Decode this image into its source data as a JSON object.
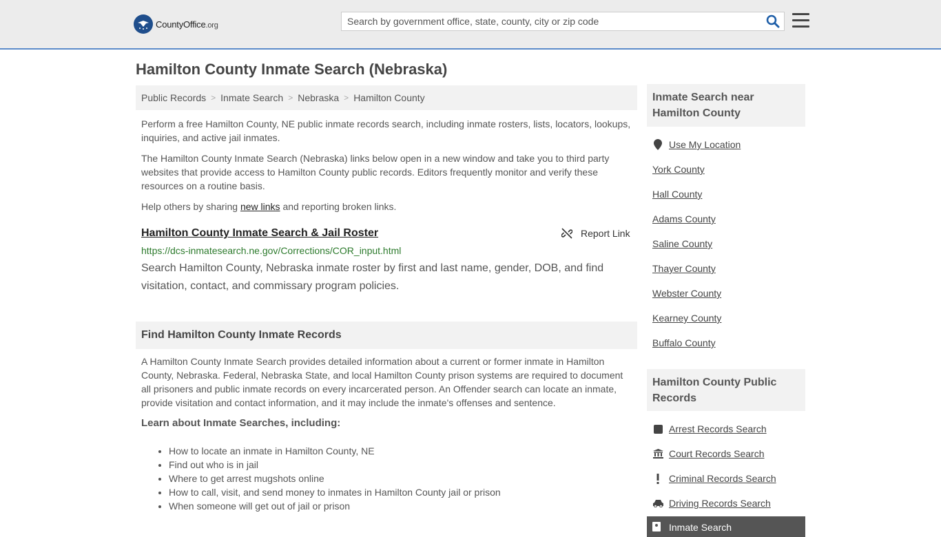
{
  "header": {
    "logo_text": "CountyOffice",
    "logo_suffix": ".org",
    "search_placeholder": "Search by government office, state, county, city or zip code"
  },
  "page_title": "Hamilton County Inmate Search (Nebraska)",
  "breadcrumb": [
    "Public Records",
    "Inmate Search",
    "Nebraska",
    "Hamilton County"
  ],
  "intro": {
    "p1": "Perform a free Hamilton County, NE public inmate records search, including inmate rosters, lists, locators, lookups, inquiries, and active jail inmates.",
    "p2": "The Hamilton County Inmate Search (Nebraska) links below open in a new window and take you to third party websites that provide access to Hamilton County public records. Editors frequently monitor and verify these resources on a routine basis.",
    "p3_before": "Help others by sharing ",
    "p3_link": "new links",
    "p3_after": " and reporting broken links."
  },
  "listing": {
    "title": "Hamilton County Inmate Search & Jail Roster",
    "report_label": "Report Link",
    "url": "https://dcs-inmatesearch.ne.gov/Corrections/COR_input.html",
    "description": "Search Hamilton County, Nebraska inmate roster by first and last name, gender, DOB, and find visitation, contact, and commissary program policies."
  },
  "find_section": {
    "heading": "Find Hamilton County Inmate Records",
    "body": "A Hamilton County Inmate Search provides detailed information about a current or former inmate in Hamilton County, Nebraska. Federal, Nebraska State, and local Hamilton County prison systems are required to document all prisoners and public inmate records on every incarcerated person. An Offender search can locate an inmate, provide visitation and contact information, and it may include the inmate's offenses and sentence.",
    "learn_heading": "Learn about Inmate Searches, including:",
    "bullets": [
      "How to locate an inmate in Hamilton County, NE",
      "Find out who is in jail",
      "Where to get arrest mugshots online",
      "How to call, visit, and send money to inmates in Hamilton County jail or prison",
      "When someone will get out of jail or prison"
    ]
  },
  "sidebar": {
    "nearby_heading": "Inmate Search near Hamilton County",
    "use_location": "Use My Location",
    "nearby": [
      "York County",
      "Hall County",
      "Adams County",
      "Saline County",
      "Thayer County",
      "Webster County",
      "Kearney County",
      "Buffalo County"
    ],
    "records_heading": "Hamilton County Public Records",
    "records": [
      {
        "label": "Arrest Records Search",
        "icon": "square-icon"
      },
      {
        "label": "Court Records Search",
        "icon": "courthouse-icon"
      },
      {
        "label": "Criminal Records Search",
        "icon": "exclamation-icon"
      },
      {
        "label": "Driving Records Search",
        "icon": "car-icon"
      }
    ],
    "active_item": "Inmate Search"
  }
}
